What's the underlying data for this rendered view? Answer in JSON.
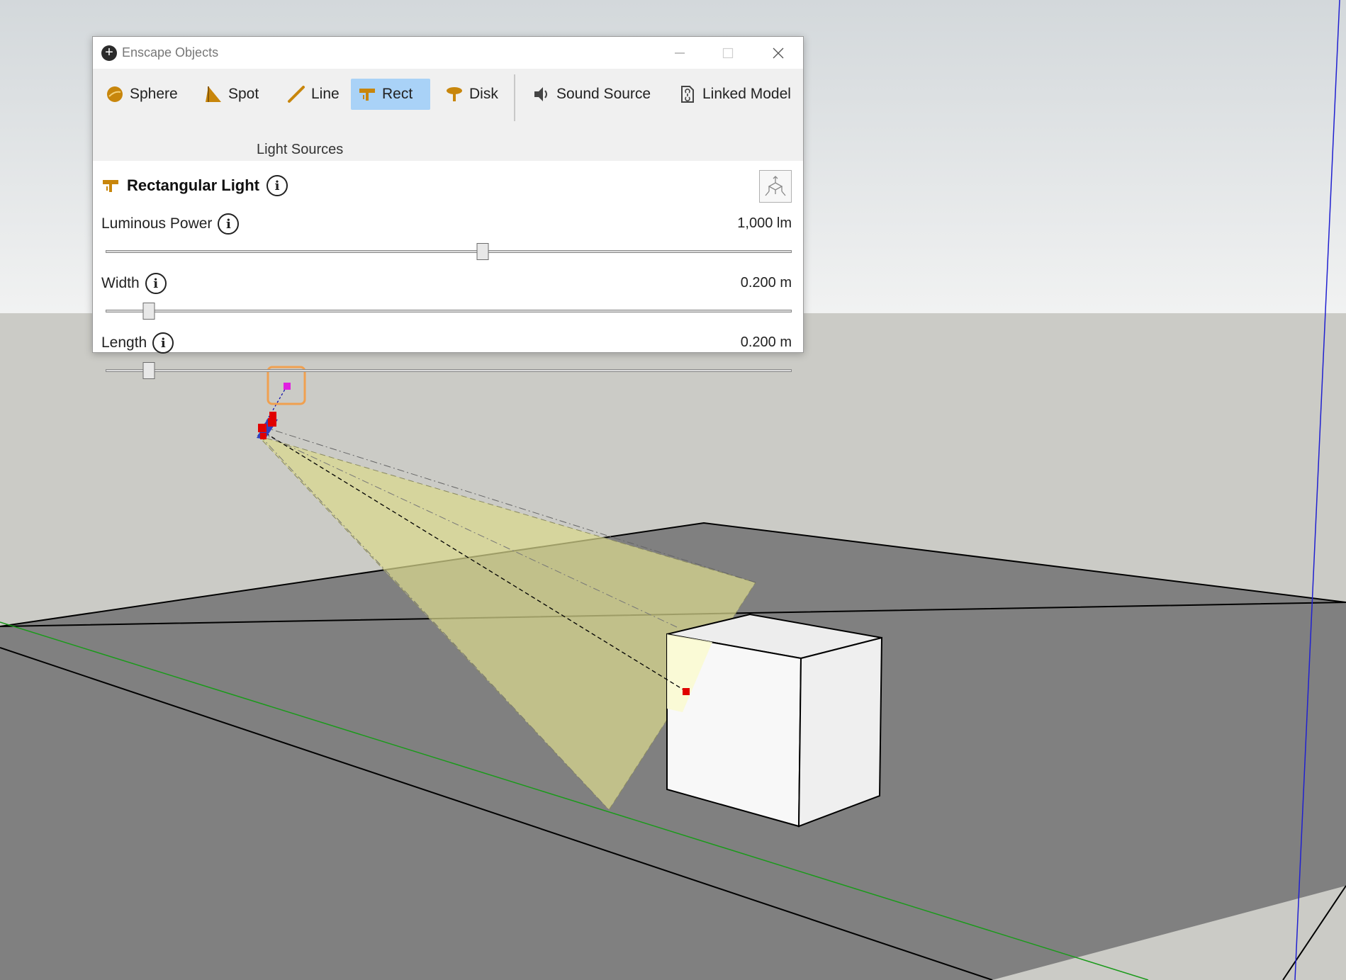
{
  "window": {
    "title": "Enscape Objects",
    "title_icon": "plus-icon",
    "controls": {
      "minimize": "minimize-icon",
      "maximize": "maximize-icon",
      "close": "close-icon"
    }
  },
  "toolbar": {
    "light_sources": [
      {
        "label": "Sphere",
        "icon": "sphere-light-icon",
        "active": false
      },
      {
        "label": "Spot",
        "icon": "spot-light-icon",
        "active": false
      },
      {
        "label": "Line",
        "icon": "line-light-icon",
        "active": false
      },
      {
        "label": "Rect",
        "icon": "rect-light-icon",
        "active": true
      },
      {
        "label": "Disk",
        "icon": "disk-light-icon",
        "active": false
      }
    ],
    "group_label": "Light Sources",
    "other": [
      {
        "label": "Sound Source",
        "icon": "speaker-icon"
      },
      {
        "label": "Linked Model",
        "icon": "linked-model-icon"
      }
    ]
  },
  "panel": {
    "heading": "Rectangular Light",
    "heading_icon": "rect-light-icon",
    "axis_button_icon": "axis-placement-icon",
    "properties": [
      {
        "label": "Luminous Power",
        "value": "1,000 lm",
        "slider_fraction": 0.55
      },
      {
        "label": "Width",
        "value": "0.200 m",
        "slider_fraction": 0.0625
      },
      {
        "label": "Length",
        "value": "0.200 m",
        "slider_fraction": 0.0625
      }
    ]
  },
  "colors": {
    "accent_active": "#a9d2f7",
    "light_icon": "#c8860c",
    "sky": "#dfe2e4",
    "ground": "#cbcbc6",
    "plane": "#808080",
    "light_cone": "#d9d88e",
    "selection_highlight": "#f0a050"
  }
}
